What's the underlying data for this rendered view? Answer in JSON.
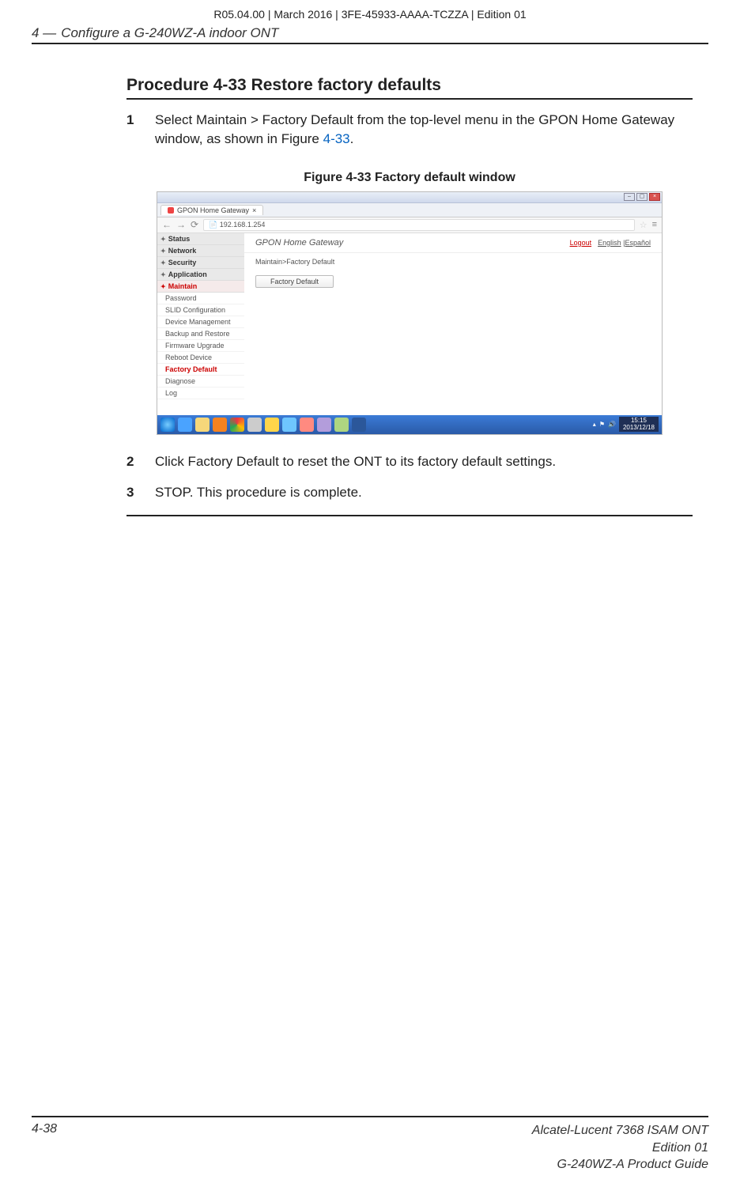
{
  "meta_line": "R05.04.00 | March 2016 | 3FE-45933-AAAA-TCZZA | Edition 01",
  "running_head": {
    "num": "4 —",
    "title": "Configure a G-240WZ-A indoor ONT"
  },
  "procedure_title": "Procedure 4-33  Restore factory defaults",
  "steps": [
    {
      "num": "1",
      "text_a": "Select Maintain > Factory Default from the top-level menu in the GPON Home Gateway window, as shown in Figure ",
      "link": "4-33",
      "text_b": "."
    },
    {
      "num": "2",
      "text_a": "Click Factory Default to reset the ONT to its factory default settings.",
      "link": "",
      "text_b": ""
    },
    {
      "num": "3",
      "text_a": "STOP. This procedure is complete.",
      "link": "",
      "text_b": ""
    }
  ],
  "figure_caption": "Figure 4-33  Factory default window",
  "screenshot": {
    "tab_title": "GPON Home Gateway",
    "url": "192.168.1.254",
    "header_title": "GPON Home Gateway",
    "logout": "Logout",
    "lang1": "English",
    "lang2": "Español",
    "breadcrumb": "Maintain>Factory Default",
    "button": "Factory Default",
    "side_cats": [
      "Status",
      "Network",
      "Security",
      "Application",
      "Maintain"
    ],
    "side_subs": [
      "Password",
      "SLID Configuration",
      "Device Management",
      "Backup and Restore",
      "Firmware Upgrade",
      "Reboot Device",
      "Factory Default",
      "Diagnose",
      "Log"
    ],
    "clock_time": "15:15",
    "clock_date": "2013/12/18"
  },
  "footer": {
    "page_num": "4-38",
    "line1": "Alcatel-Lucent 7368 ISAM ONT",
    "line2": "Edition 01",
    "line3": "G-240WZ-A Product Guide"
  }
}
